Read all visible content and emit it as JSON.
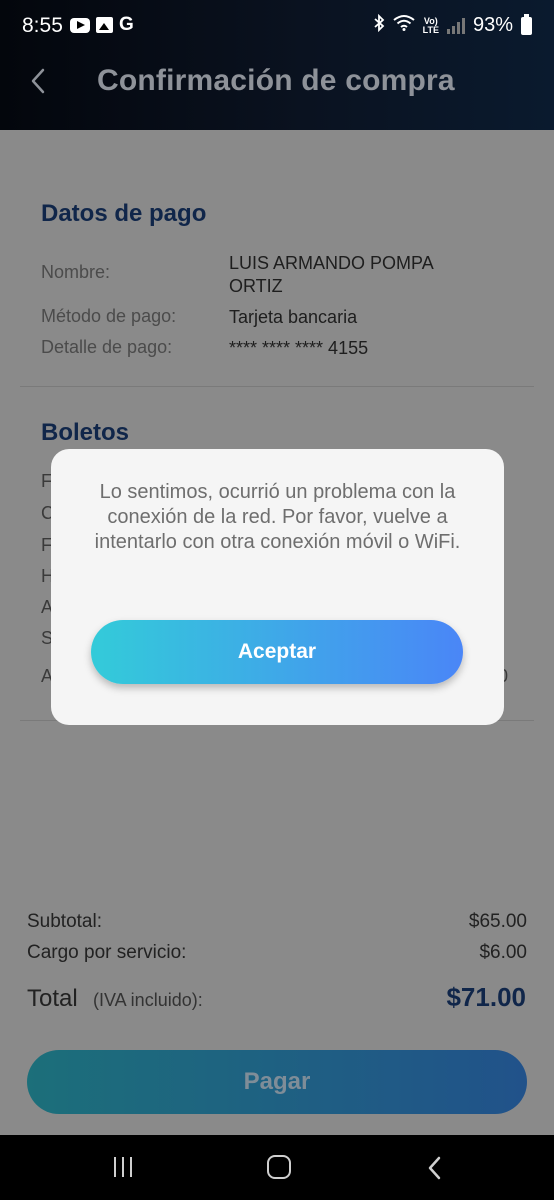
{
  "status_bar": {
    "time": "8:55",
    "g_letter": "G",
    "lte_top": "Vo)",
    "lte_bottom": "LTE",
    "battery": "93%"
  },
  "header": {
    "title": "Confirmación de compra"
  },
  "payment": {
    "section_title": "Datos de pago",
    "name_label": "Nombre:",
    "name_value": "LUIS ARMANDO POMPA ORTIZ",
    "method_label": "Método de pago:",
    "method_value": "Tarjeta bancaria",
    "detail_label": "Detalle de pago:",
    "detail_value": "**** **** **** 4155"
  },
  "tickets": {
    "section_title": "Boletos",
    "peek_letters": [
      "F",
      "C",
      "F",
      "H",
      "A",
      "S",
      "A"
    ],
    "peek_right": "0"
  },
  "summary": {
    "subtotal_label": "Subtotal:",
    "subtotal_value": "$65.00",
    "service_label": "Cargo por servicio:",
    "service_value": "$6.00",
    "total_label": "Total",
    "total_sub": "(IVA incluido):",
    "total_value": "$71.00"
  },
  "pay_button": {
    "label": "Pagar"
  },
  "dialog": {
    "message": "Lo sentimos, ocurrió un problema con la conexión de la red. Por favor, vuelve a intentarlo con otra conexión móvil o WiFi.",
    "accept_label": "Aceptar"
  },
  "colors": {
    "accent_start": "#33cbd9",
    "accent_end": "#4a86f7",
    "title_navy": "#10264a"
  }
}
